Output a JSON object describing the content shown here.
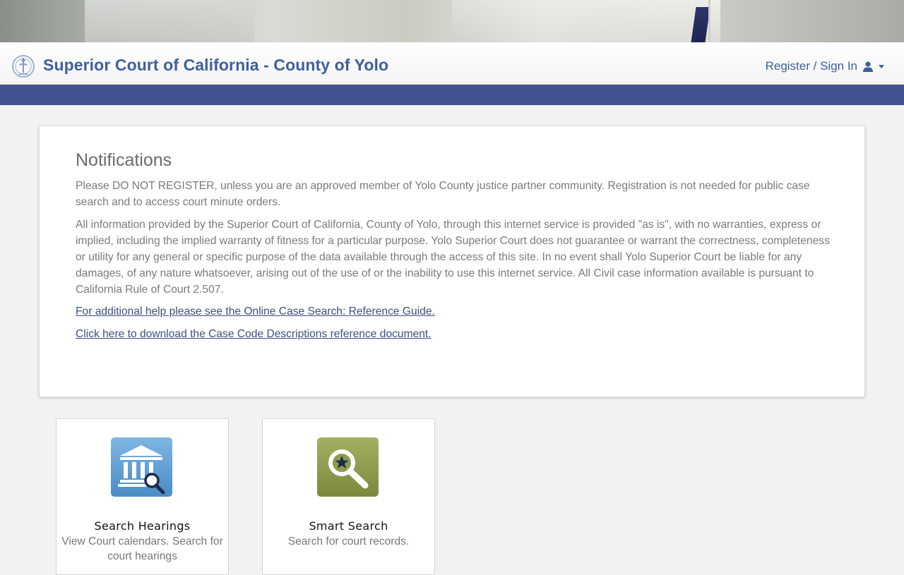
{
  "header": {
    "title": "Superior Court of California - County of Yolo",
    "user_menu_label": "Register / Sign In"
  },
  "notifications": {
    "heading": "Notifications",
    "paragraphs": [
      "Please DO NOT REGISTER, unless you are an approved member of Yolo County justice partner community. Registration is not needed for public case search and to access court minute orders.",
      "All information provided by the Superior Court of California, County of Yolo, through this internet service is provided \"as is\", with no warranties, express or implied, including the implied warranty of fitness for a particular purpose. Yolo Superior Court does not guarantee or warrant the correctness, completeness or utility for any general or specific purpose of the data available through the access of this site. In no event shall Yolo Superior Court be liable for any damages, of any nature whatsoever, arising out of the use of or the inability to use this internet service. All Civil case information available is pursuant to California Rule of Court 2.507."
    ],
    "links": [
      "For additional help please see the Online Case Search: Reference Guide.",
      "Click here to download the Case Code Descriptions reference document."
    ]
  },
  "tiles": [
    {
      "title": "Search Hearings",
      "description": "View Court calendars. Search for court hearings",
      "icon": "courthouse-search-icon",
      "color": "#5b9bd0"
    },
    {
      "title": "Smart Search",
      "description": "Search for court records.",
      "icon": "magnifier-star-icon",
      "color": "#8a9a4a"
    }
  ],
  "colors": {
    "brand": "#3f5f9c",
    "nav_strip": "#42528f",
    "background": "#f2f2f2"
  }
}
